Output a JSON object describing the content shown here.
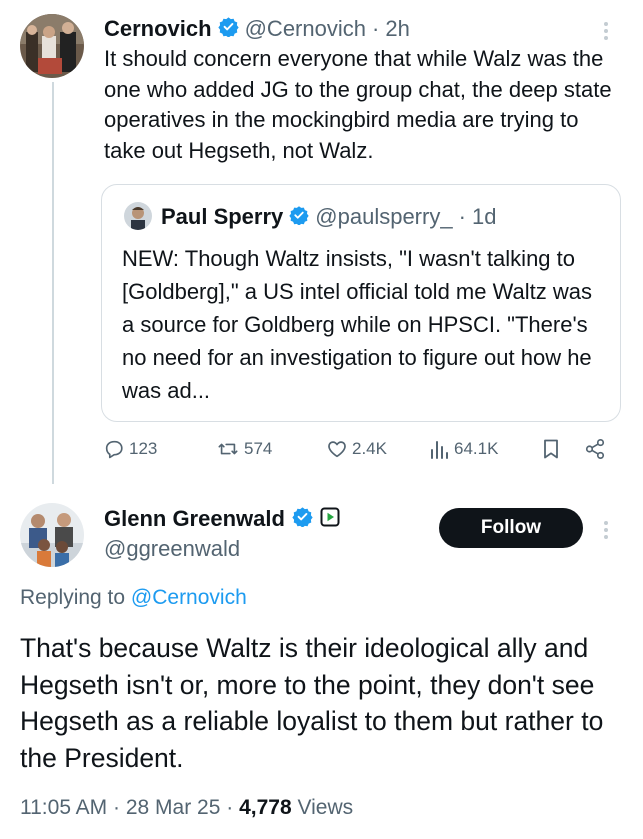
{
  "tweet1": {
    "name": "Cernovich",
    "handle": "@Cernovich",
    "time": "· 2h",
    "text": "It should concern everyone that while Walz was the one who added JG to the group chat, the deep state operatives in the mockingbird media are trying to take out Hegseth, not Walz."
  },
  "quote": {
    "name": "Paul Sperry",
    "handle": "@paulsperry_",
    "time": "· 1d",
    "text": "NEW: Though Waltz insists, \"I wasn't talking to [Goldberg],\" a US intel official told me Waltz was a source for Goldberg while on HPSCI. \"There's no need for an investigation to figure out how he was ad..."
  },
  "actions": {
    "replies": "123",
    "retweets": "574",
    "likes": "2.4K",
    "views": "64.1K"
  },
  "tweet2": {
    "name": "Glenn Greenwald",
    "handle": "@ggreenwald",
    "follow_label": "Follow",
    "replying_prefix": "Replying to",
    "replying_handle": "@Cernovich",
    "text": "That's because Waltz is their ideological ally and Hegseth isn't or, more to the point, they don't see Hegseth as a reliable loyalist to them but rather to the President.",
    "time": "11:05 AM",
    "date": "28 Mar 25",
    "views_count": "4,778",
    "views_label": "Views"
  },
  "colors": {
    "verified": "#1d9bf0",
    "secondary_text": "#536471",
    "link": "#1d9bf0",
    "follow_bg": "#0f1419"
  },
  "icons": [
    "verified-icon",
    "reply-icon",
    "retweet-icon",
    "like-icon",
    "views-icon",
    "bookmark-icon",
    "share-icon",
    "more-icon",
    "video-badge-icon"
  ]
}
